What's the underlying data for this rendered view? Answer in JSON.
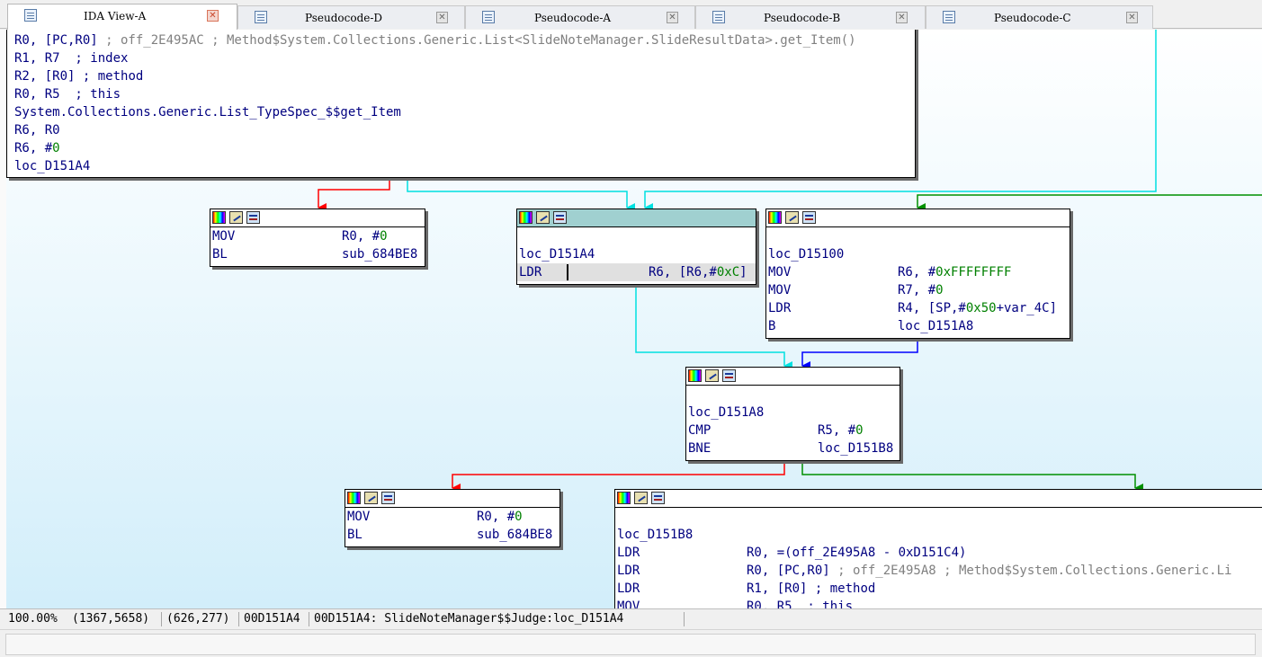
{
  "tabs": [
    {
      "label": "IDA View-A",
      "active": true
    },
    {
      "label": "Pseudocode-D",
      "active": false
    },
    {
      "label": "Pseudocode-A",
      "active": false
    },
    {
      "label": "Pseudocode-B",
      "active": false
    },
    {
      "label": "Pseudocode-C",
      "active": false
    }
  ],
  "nodes": {
    "top": {
      "lines": [
        {
          "operand": "R0, [PC,R0]",
          "comment": " ; off_2E495AC ; Method$System.Collections.Generic.List<SlideNoteManager.SlideResultData>.get_Item()"
        },
        {
          "operand": "R1, R7",
          "comment": "  ; index"
        },
        {
          "operand": "R2, [R0]",
          "comment": " ; method"
        },
        {
          "operand": "R0, R5",
          "comment": "  ; this"
        },
        {
          "operand": "System.Collections.Generic.List_TypeSpec_$$get_Item",
          "comment": ""
        },
        {
          "operand": "R6, R0",
          "comment": ""
        },
        {
          "operand": "R6, #",
          "imm": "0",
          "comment": ""
        },
        {
          "operand": "loc_D151A4",
          "comment": ""
        }
      ]
    },
    "left1": {
      "lines": [
        {
          "mnemonic": "MOV",
          "operand": "R0, #",
          "imm": "0"
        },
        {
          "mnemonic": "BL",
          "operand": "sub_684BE8"
        }
      ]
    },
    "mid": {
      "label": "loc_D151A4",
      "lines": [
        {
          "mnemonic": "LDR",
          "operand": "R6, [R6,#",
          "imm": "0xC",
          "tail": "]"
        }
      ]
    },
    "right1": {
      "label": "loc_D15100",
      "lines": [
        {
          "mnemonic": "MOV",
          "operand": "R6, #",
          "imm": "0xFFFFFFFF",
          "tail": ""
        },
        {
          "mnemonic": "MOV",
          "operand": "R7, #",
          "imm": "0",
          "tail": ""
        },
        {
          "mnemonic": "LDR",
          "operand": "R4, [SP,#",
          "imm": "0x50",
          "tail": "+var_4C]"
        },
        {
          "mnemonic": "B",
          "operand": "loc_D151A8",
          "imm": "",
          "tail": ""
        }
      ]
    },
    "center": {
      "label": "loc_D151A8",
      "lines": [
        {
          "mnemonic": "CMP",
          "operand": "R5, #",
          "imm": "0"
        },
        {
          "mnemonic": "BNE",
          "operand": "loc_D151B8",
          "imm": ""
        }
      ]
    },
    "left2": {
      "lines": [
        {
          "mnemonic": "MOV",
          "operand": "R0, #",
          "imm": "0"
        },
        {
          "mnemonic": "BL",
          "operand": "sub_684BE8"
        }
      ]
    },
    "bottom": {
      "label": "loc_D151B8",
      "lines": [
        {
          "mnemonic": "LDR",
          "operand": "R0, =(off_2E495A8 - 0xD151C4)",
          "comment": ""
        },
        {
          "mnemonic": "LDR",
          "operand": "R0, [PC,R0]",
          "comment": " ; off_2E495A8 ; Method$System.Collections.Generic.Li"
        },
        {
          "mnemonic": "LDR",
          "operand": "R1, [R0]",
          "comment": " ; method"
        },
        {
          "mnemonic": "MOV",
          "operand": "R0, R5",
          "comment": "  ; this"
        }
      ]
    }
  },
  "status": {
    "zoom": "100.00%",
    "graph_coords": "(1367,5658)",
    "mouse_coords": "(626,277)",
    "address": "00D151A4",
    "location": "00D151A4: SlideNoteManager$$Judge:loc_D151A4"
  },
  "colors": {
    "edge_false": "#ff0000",
    "edge_true": "#009000",
    "edge_cyan": "#00e0e0",
    "edge_blue": "#0000ff"
  }
}
